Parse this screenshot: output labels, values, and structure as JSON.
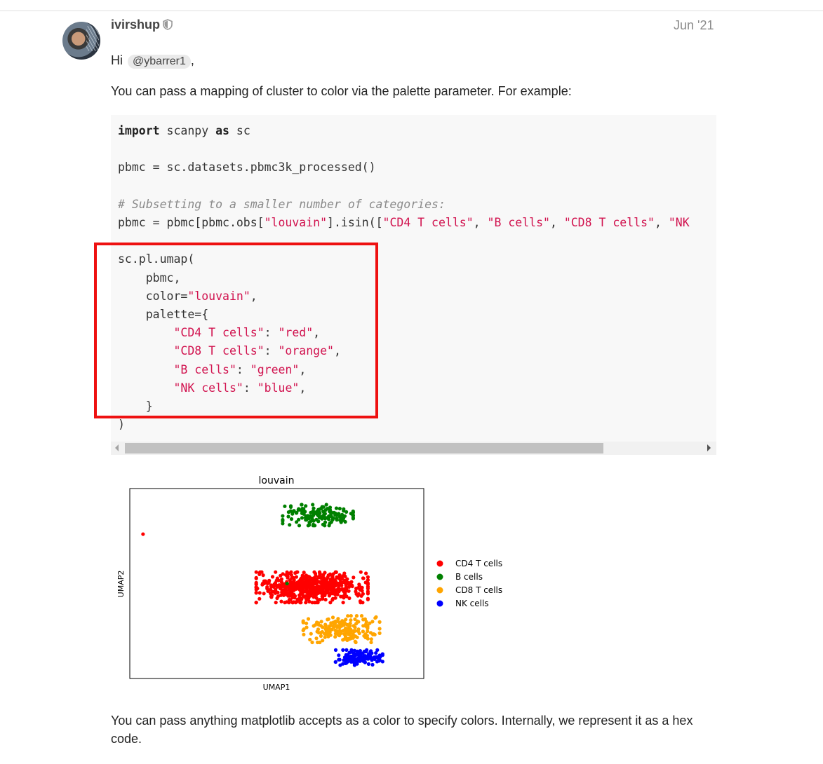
{
  "post": {
    "username": "ivirshup",
    "date": "Jun '21",
    "greeting_prefix": "Hi",
    "mention": "@ybarrer1",
    "greeting_suffix": ",",
    "paragraph1": "You can pass a mapping of cluster to color via the palette parameter. For example:",
    "paragraph2": "You can pass anything matplotlib accepts as a color to specify colors. Internally, we represent it as a hex code."
  },
  "code": {
    "kw_import": "import",
    "l1_mod": " scanpy ",
    "kw_as": "as",
    "l1_alias": " sc",
    "l3": "pbmc = sc.datasets.pbmc3k_processed()",
    "l5_comment": "# Subsetting to a smaller number of categories:",
    "l6_a": "pbmc = pbmc[pbmc.obs[",
    "l6_s1": "\"louvain\"",
    "l6_b": "].isin([",
    "l6_s2": "\"CD4 T cells\"",
    "l6_c": ", ",
    "l6_s3": "\"B cells\"",
    "l6_d": ", ",
    "l6_s4": "\"CD8 T cells\"",
    "l6_e": ", ",
    "l6_s5": "\"NK",
    "l8": "sc.pl.umap(",
    "l9": "    pbmc,",
    "l10_a": "    color=",
    "l10_s": "\"louvain\"",
    "l10_b": ",",
    "l11": "    palette={",
    "l12_ind": "        ",
    "l12_k": "\"CD4 T cells\"",
    "l12_c": ": ",
    "l12_v": "\"red\"",
    "l12_e": ",",
    "l13_ind": "        ",
    "l13_k": "\"CD8 T cells\"",
    "l13_c": ": ",
    "l13_v": "\"orange\"",
    "l13_e": ",",
    "l14_ind": "        ",
    "l14_k": "\"B cells\"",
    "l14_c": ": ",
    "l14_v": "\"green\"",
    "l14_e": ",",
    "l15_ind": "        ",
    "l15_k": "\"NK cells\"",
    "l15_c": ": ",
    "l15_v": "\"blue\"",
    "l15_e": ",",
    "l16": "    }",
    "l17": ")"
  },
  "colors": {
    "highlight_box": "#ee1111",
    "code_string": "#d1134f",
    "code_bg": "#f8f8f8"
  },
  "chart_data": {
    "type": "scatter",
    "title": "louvain",
    "xlabel": "UMAP1",
    "ylabel": "UMAP2",
    "grid": false,
    "legend_position": "right",
    "series": [
      {
        "name": "CD4 T cells",
        "color": "#ff0000",
        "cluster_center": [
          0.62,
          0.48
        ],
        "cluster_spread": [
          0.19,
          0.08
        ],
        "n_points": 600
      },
      {
        "name": "B cells",
        "color": "#008000",
        "cluster_center": [
          0.64,
          0.86
        ],
        "cluster_spread": [
          0.12,
          0.055
        ],
        "n_points": 150
      },
      {
        "name": "CD8 T cells",
        "color": "#ffa500",
        "cluster_center": [
          0.72,
          0.26
        ],
        "cluster_spread": [
          0.13,
          0.07
        ],
        "n_points": 180
      },
      {
        "name": "NK cells",
        "color": "#0000ff",
        "cluster_center": [
          0.78,
          0.11
        ],
        "cluster_spread": [
          0.08,
          0.04
        ],
        "n_points": 130
      }
    ],
    "outliers": [
      {
        "series": "CD4 T cells",
        "x": 0.045,
        "y": 0.76
      },
      {
        "series": "CD4 T cells",
        "x": 0.47,
        "y": 0.46
      },
      {
        "series": "CD4 T cells",
        "x": 0.53,
        "y": 0.45
      },
      {
        "series": "B cells",
        "x": 0.535,
        "y": 0.5
      }
    ]
  }
}
